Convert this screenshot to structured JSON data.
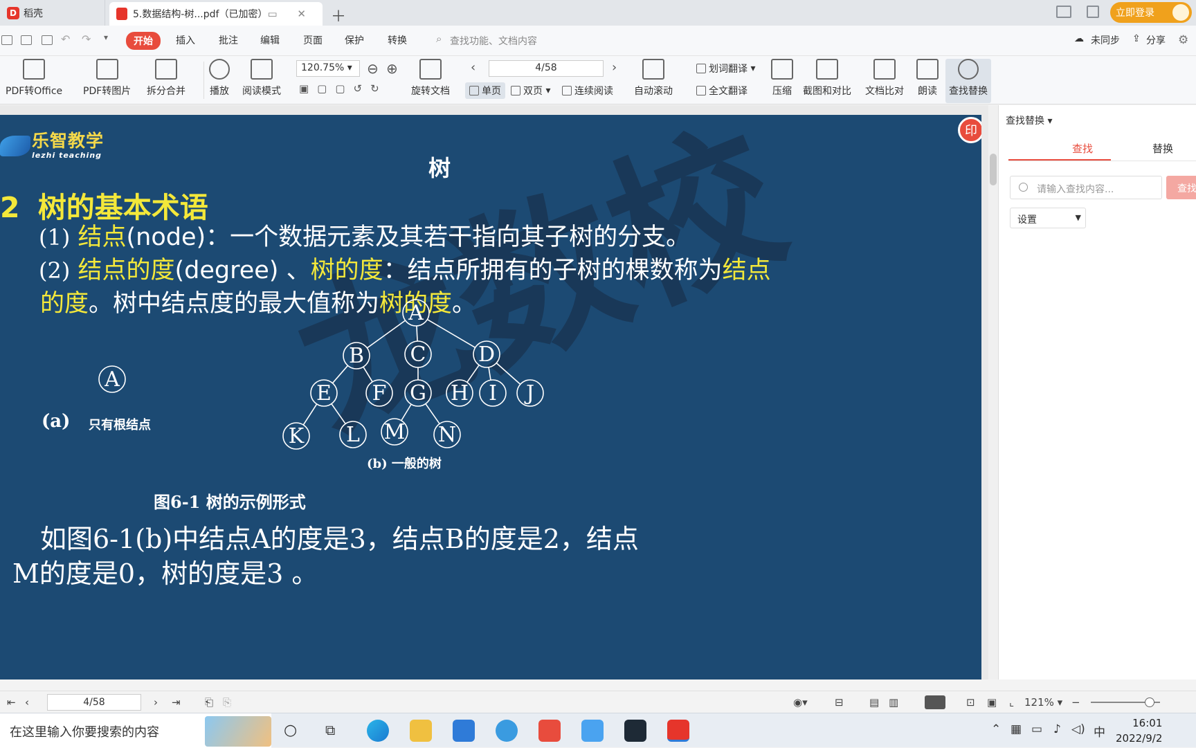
{
  "tabs": {
    "home_label": "稻壳",
    "doc_label": "5.数据结构-树...pdf（已加密）",
    "login_label": "立即登录"
  },
  "menu": {
    "items": [
      "开始",
      "插入",
      "批注",
      "编辑",
      "页面",
      "保护",
      "转换"
    ],
    "search_placeholder": "查找功能、文档内容",
    "sync_label": "未同步",
    "share_label": "分享"
  },
  "ribbon": {
    "pdf_to_office": "PDF转Office",
    "pdf_to_image": "PDF转图片",
    "split_merge": "拆分合并",
    "play": "播放",
    "read_mode": "阅读模式",
    "zoom_value": "120.75%",
    "rotate_doc": "旋转文档",
    "page_value": "4/58",
    "single_page": "单页",
    "double_page": "双页",
    "continuous": "连续阅读",
    "auto_scroll": "自动滚动",
    "word_translate": "划词翻译",
    "full_translate": "全文翻译",
    "compress": "压缩",
    "screenshot_compare": "截图和对比",
    "doc_compare": "文档比对",
    "read_aloud": "朗读",
    "find_replace": "查找替换"
  },
  "slide": {
    "brand_cn": "乐智教学",
    "brand_en": "lezhi teaching",
    "title": "树",
    "badge": "印",
    "section_num": "2",
    "section_title": "树的基本术语",
    "p1_num": "(1)",
    "p1_hl": "结点",
    "p1_rest": "(node)：一个数据元素及其若干指向其子树的分支。",
    "p2_num": "(2)",
    "p2_hl1": "结点的度",
    "p2_mid1": "(degree) 、",
    "p2_hl2": "树的度",
    "p2_mid2": "：结点所拥有的子树的棵数称为",
    "p2_hl3": "结点",
    "p3_hl1": "的度",
    "p3_mid": "。树中结点度的最大值称为",
    "p3_hl2": "树的度",
    "p3_end": "。",
    "tree_nodes": [
      "A",
      "B",
      "C",
      "D",
      "E",
      "F",
      "G",
      "H",
      "I",
      "J",
      "K",
      "L",
      "M",
      "N"
    ],
    "root_only_node": "A",
    "cap_a_label": "(a)",
    "cap_a_text": "只有根结点",
    "cap_b": "(b)   一般的树",
    "fig_caption": "图6-1   树的示例形式",
    "body_line1": "如图6-1(b)中结点A的度是3，结点B的度是2，结点",
    "body_line2": "M的度是0，树的度是3 。",
    "watermark": "龙数校"
  },
  "panel": {
    "title": "查找替换",
    "tab_find": "查找",
    "tab_replace": "替换",
    "search_placeholder": "请输入查找内容...",
    "search_button": "查找",
    "settings_label": "设置"
  },
  "status": {
    "page_value": "4/58",
    "zoom_value": "121%"
  },
  "taskbar": {
    "search_placeholder": "在这里输入你要搜索的内容",
    "ime": "中",
    "time": "16:01",
    "date": "2022/9/2"
  },
  "colors": {
    "accent": "#e84c3d",
    "slide_bg": "#1c4a73",
    "highlight": "#f4e83a",
    "login_orange": "#f0a11c"
  }
}
